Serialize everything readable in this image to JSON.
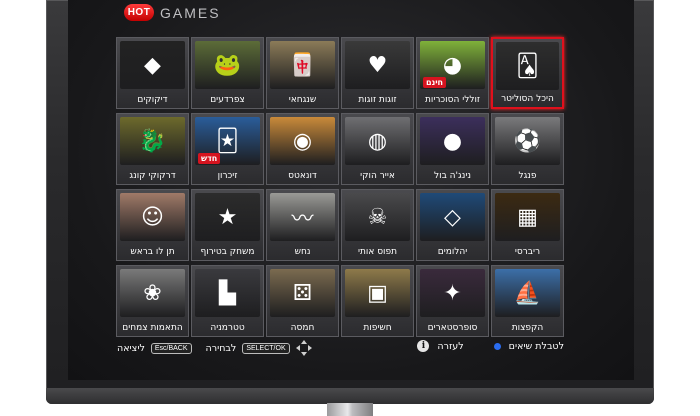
{
  "brand": {
    "hot": "HOT",
    "games": "GAMES"
  },
  "tiles": [
    {
      "id": "solitaire",
      "label": "היכל הסוליטר",
      "art": "🂡",
      "color": "#2e2e2e",
      "selected": true
    },
    {
      "id": "pacman",
      "label": "זוללי הסוכריות",
      "art": "◕",
      "color": "#7fb13a",
      "badge": "חינם"
    },
    {
      "id": "pairs",
      "label": "זוגות זוגות",
      "art": "♥",
      "color": "#3a3a3a"
    },
    {
      "id": "mahjong",
      "label": "שנגחאי",
      "art": "🀄",
      "color": "#8b7b58"
    },
    {
      "id": "frogs",
      "label": "צפרדעים",
      "art": "🐸",
      "color": "#5c6c38"
    },
    {
      "id": "diamonds",
      "label": "דיקוקים",
      "art": "◆",
      "color": "#222222"
    },
    {
      "id": "penalty",
      "label": "פנגל",
      "art": "⚽",
      "color": "#7a7a7c"
    },
    {
      "id": "ninja",
      "label": "נינג'ה בול",
      "art": "●",
      "color": "#3c2f5c"
    },
    {
      "id": "airhockey",
      "label": "אייר הוקי",
      "art": "◍",
      "color": "#6f6f72"
    },
    {
      "id": "donut",
      "label": "דונאטס",
      "art": "◉",
      "color": "#c98a3a"
    },
    {
      "id": "memory",
      "label": "זיכרון",
      "art": "🃏",
      "color": "#2a5d9a",
      "badge": "חדש"
    },
    {
      "id": "dragon",
      "label": "דרקוקי קונג",
      "art": "🐉",
      "color": "#6d6a2c"
    },
    {
      "id": "reversi",
      "label": "ריברסי",
      "art": "▦",
      "color": "#3c2a12"
    },
    {
      "id": "diamonds2",
      "label": "יהלומים",
      "art": "◇",
      "color": "#1f4a78"
    },
    {
      "id": "catch",
      "label": "תפוס אותי",
      "art": "☠",
      "color": "#4a4a4c"
    },
    {
      "id": "snake",
      "label": "נחש",
      "art": "〰",
      "color": "#9a9a96"
    },
    {
      "id": "circus",
      "label": "משחק בטירוף",
      "art": "★",
      "color": "#2c2c2c"
    },
    {
      "id": "head",
      "label": "תן לו בראש",
      "art": "☺",
      "color": "#a07a68"
    },
    {
      "id": "jumps",
      "label": "הקפצות",
      "art": "⛵",
      "color": "#3c6fa8"
    },
    {
      "id": "superstars",
      "label": "סופרסטארים",
      "art": "✦",
      "color": "#3a2a3c"
    },
    {
      "id": "chasfanim",
      "label": "חשיפות",
      "art": "▣",
      "color": "#8e7a4a"
    },
    {
      "id": "dice",
      "label": "חמסה",
      "art": "⚄",
      "color": "#7b6b50"
    },
    {
      "id": "tetris",
      "label": "טטרמניה",
      "art": "▙",
      "color": "#3a3a3e"
    },
    {
      "id": "plants",
      "label": "התאמות צמחים",
      "art": "❀",
      "color": "#7a7a7a"
    }
  ],
  "footer": {
    "exit_label": "ליציאה",
    "exit_key": "Esc/BACK",
    "select_label": "לבחירה",
    "select_key": "SELECT/OK",
    "scores_label": "לטבלת שיאים",
    "help_label": "לעזרה"
  }
}
